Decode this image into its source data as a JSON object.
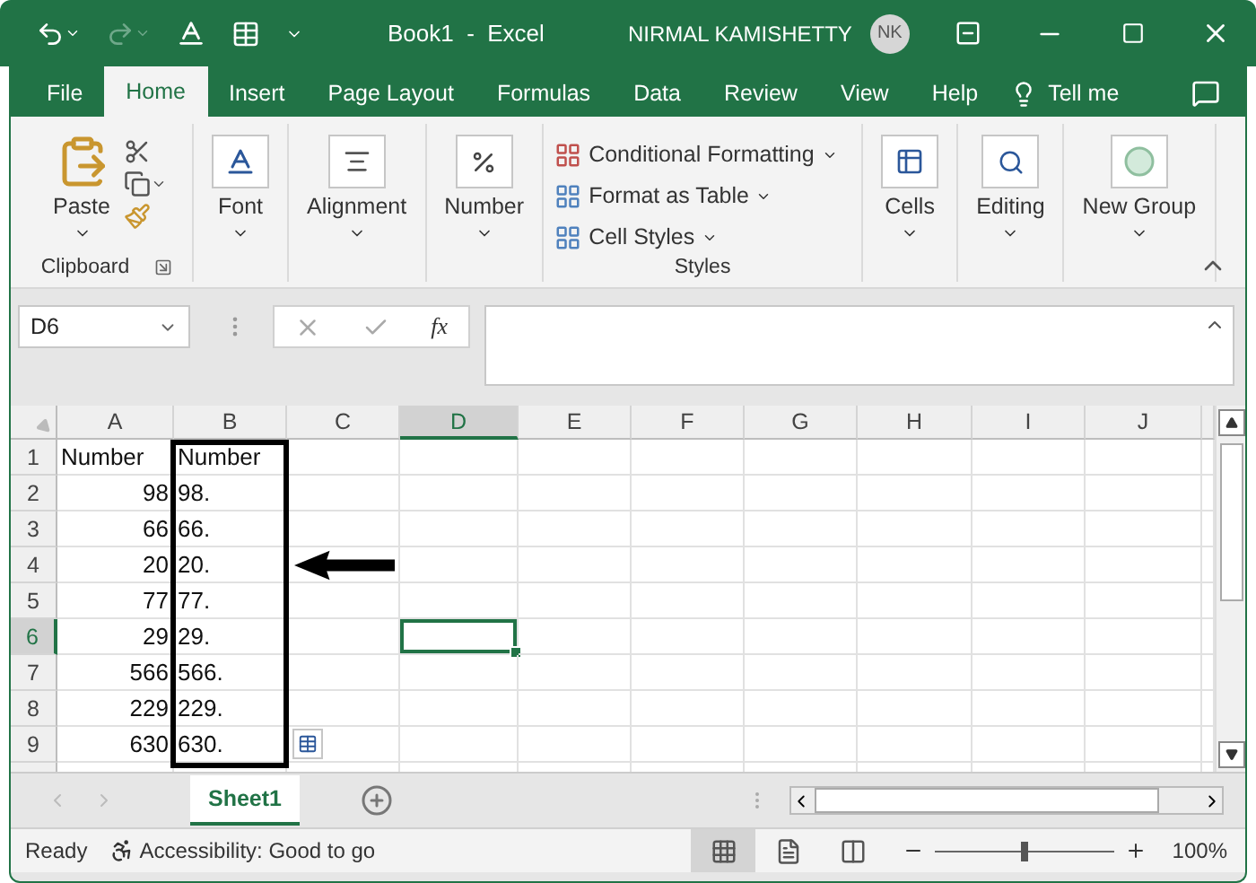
{
  "title_bar": {
    "quick_access": [
      {
        "kind": "undo",
        "disabled": false
      },
      {
        "kind": "redo",
        "disabled": true
      },
      {
        "kind": "font_color",
        "disabled": false
      },
      {
        "kind": "table",
        "disabled": false
      },
      {
        "kind": "customize",
        "disabled": false
      }
    ],
    "title": "Book1  -  Excel",
    "user": "NIRMAL KAMISHETTY",
    "initials": "NK"
  },
  "tabs": [
    {
      "label": "File",
      "selected": false
    },
    {
      "label": "Home",
      "selected": true
    },
    {
      "label": "Insert",
      "selected": false
    },
    {
      "label": "Page Layout",
      "selected": false
    },
    {
      "label": "Formulas",
      "selected": false
    },
    {
      "label": "Data",
      "selected": false
    },
    {
      "label": "Review",
      "selected": false
    },
    {
      "label": "View",
      "selected": false
    },
    {
      "label": "Help",
      "selected": false
    }
  ],
  "tell_me": "Tell me",
  "ribbon": {
    "groups": [
      {
        "kind": "clipboard",
        "label": "Clipboard",
        "button": "Paste"
      },
      {
        "kind": "font",
        "button": "Font"
      },
      {
        "kind": "alignment",
        "button": "Alignment"
      },
      {
        "kind": "number",
        "button": "Number"
      },
      {
        "kind": "styles",
        "label": "Styles",
        "items": [
          "Conditional Formatting",
          "Format as Table",
          "Cell Styles"
        ]
      },
      {
        "kind": "cells",
        "button": "Cells"
      },
      {
        "kind": "editing",
        "button": "Editing"
      },
      {
        "kind": "new_group",
        "button": "New Group"
      }
    ]
  },
  "formula_bar": {
    "name_box": "D6",
    "function_button": "fx"
  },
  "columns": [
    {
      "label": "A",
      "selected": false
    },
    {
      "label": "B",
      "selected": false
    },
    {
      "label": "C",
      "selected": false
    },
    {
      "label": "D",
      "selected": true
    },
    {
      "label": "E",
      "selected": false
    },
    {
      "label": "F",
      "selected": false
    },
    {
      "label": "G",
      "selected": false
    },
    {
      "label": "H",
      "selected": false
    },
    {
      "label": "I",
      "selected": false
    },
    {
      "label": "J",
      "selected": false
    }
  ],
  "rows": [
    {
      "header": "1",
      "selected": false,
      "cells": [
        {
          "text": "Number",
          "kind": "text"
        },
        {
          "text": "Number",
          "kind": "text"
        }
      ]
    },
    {
      "header": "2",
      "selected": false,
      "cells": [
        {
          "text": "98",
          "kind": "number"
        },
        {
          "text": "98.",
          "kind": "text"
        }
      ]
    },
    {
      "header": "3",
      "selected": false,
      "cells": [
        {
          "text": "66",
          "kind": "number"
        },
        {
          "text": "66.",
          "kind": "text"
        }
      ]
    },
    {
      "header": "4",
      "selected": false,
      "cells": [
        {
          "text": "20",
          "kind": "number"
        },
        {
          "text": "20.",
          "kind": "text"
        }
      ]
    },
    {
      "header": "5",
      "selected": false,
      "cells": [
        {
          "text": "77",
          "kind": "number"
        },
        {
          "text": "77.",
          "kind": "text"
        }
      ]
    },
    {
      "header": "6",
      "selected": true,
      "cells": [
        {
          "text": "29",
          "kind": "number"
        },
        {
          "text": "29.",
          "kind": "text"
        }
      ]
    },
    {
      "header": "7",
      "selected": false,
      "cells": [
        {
          "text": "566",
          "kind": "number"
        },
        {
          "text": "566.",
          "kind": "text"
        }
      ]
    },
    {
      "header": "8",
      "selected": false,
      "cells": [
        {
          "text": "229",
          "kind": "number"
        },
        {
          "text": "229.",
          "kind": "text"
        }
      ]
    },
    {
      "header": "9",
      "selected": false,
      "cells": [
        {
          "text": "630",
          "kind": "number"
        },
        {
          "text": "630.",
          "kind": "text"
        }
      ]
    }
  ],
  "sheet_tabs": [
    {
      "label": "Sheet1",
      "selected": true
    }
  ],
  "status_bar": {
    "status": "Ready",
    "accessibility": "Accessibility: Good to go",
    "views": [
      {
        "kind": "normal",
        "selected": true
      },
      {
        "kind": "page_layout",
        "selected": false
      },
      {
        "kind": "page_break",
        "selected": false
      }
    ],
    "zoom": {
      "level": 0.5
    },
    "zoom_text": "100%"
  }
}
